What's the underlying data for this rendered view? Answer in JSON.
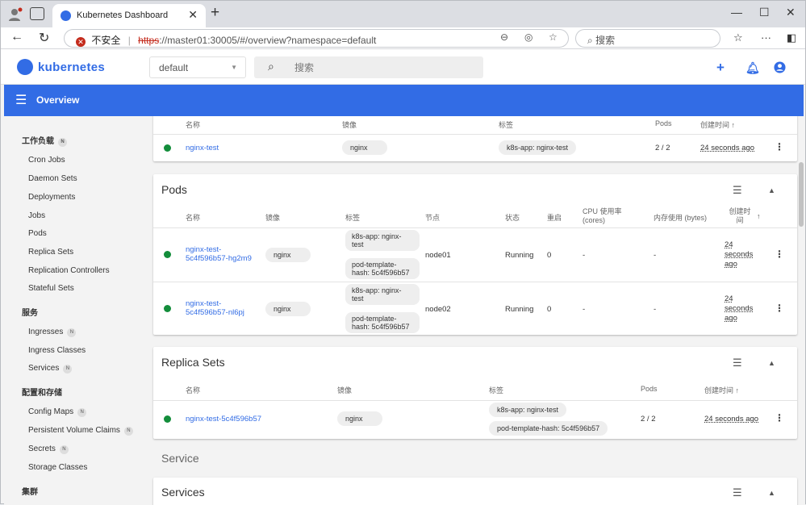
{
  "browser": {
    "tab_title": "Kubernetes Dashboard",
    "url_security": "不安全",
    "url_https": "https",
    "url_rest": "://master01:30005/#/overview?namespace=default",
    "search_placeholder": "搜索"
  },
  "app": {
    "brand": "kubernetes",
    "namespace": "default",
    "search_placeholder": "搜索",
    "toolbar_title": "Overview"
  },
  "sidebar": {
    "workloads": "工作负载",
    "workload_items": [
      "Cron Jobs",
      "Daemon Sets",
      "Deployments",
      "Jobs",
      "Pods",
      "Replica Sets",
      "Replication Controllers",
      "Stateful Sets"
    ],
    "service": "服务",
    "service_items": [
      "Ingresses",
      "Ingress Classes",
      "Services"
    ],
    "config": "配置和存储",
    "config_items": [
      "Config Maps",
      "Persistent Volume Claims",
      "Secrets",
      "Storage Classes"
    ],
    "cluster": "集群",
    "badge": "N"
  },
  "deployments": {
    "headers": {
      "name": "名称",
      "image": "镜像",
      "labels": "标签",
      "pods": "Pods",
      "created": "创建时间 ↑"
    },
    "row": {
      "name": "nginx-test",
      "image": "nginx",
      "label": "k8s-app: nginx-test",
      "pods": "2 / 2",
      "created": "24 seconds ago"
    }
  },
  "pods": {
    "title": "Pods",
    "headers": {
      "name": "名称",
      "image": "镜像",
      "labels": "标签",
      "node": "节点",
      "status": "状态",
      "restarts": "重启",
      "cpu": "CPU 使用率 (cores)",
      "mem": "内存使用 (bytes)",
      "created": "创建时间"
    },
    "rows": [
      {
        "name": "nginx-test-5c4f596b57-hg2m9",
        "image": "nginx",
        "label1": "k8s-app: nginx-test",
        "label2": "pod-template-hash: 5c4f596b57",
        "node": "node01",
        "status": "Running",
        "restarts": "0",
        "cpu": "-",
        "mem": "-",
        "created": "24 seconds ago"
      },
      {
        "name": "nginx-test-5c4f596b57-nl6pj",
        "image": "nginx",
        "label1": "k8s-app: nginx-test",
        "label2": "pod-template-hash: 5c4f596b57",
        "node": "node02",
        "status": "Running",
        "restarts": "0",
        "cpu": "-",
        "mem": "-",
        "created": "24 seconds ago"
      }
    ]
  },
  "replicasets": {
    "title": "Replica Sets",
    "headers": {
      "name": "名称",
      "image": "镜像",
      "labels": "标签",
      "pods": "Pods",
      "created": "创建时间 ↑"
    },
    "row": {
      "name": "nginx-test-5c4f596b57",
      "image": "nginx",
      "label1": "k8s-app: nginx-test",
      "label2": "pod-template-hash: 5c4f596b57",
      "pods": "2 / 2",
      "created": "24 seconds ago"
    }
  },
  "service_section": "Service",
  "services_card_title": "Services",
  "colors": {
    "accent": "#326ce5",
    "running": "#138d3b"
  }
}
